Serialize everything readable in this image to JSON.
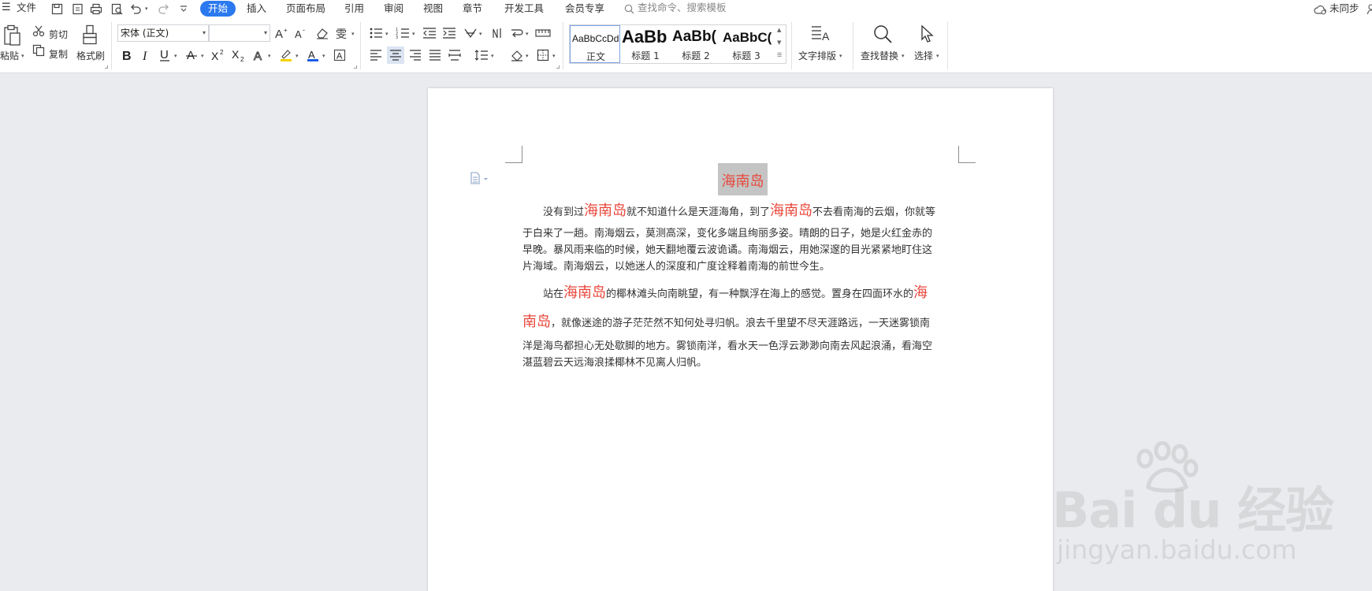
{
  "menubar": {
    "file_label": "文件",
    "tabs": [
      "开始",
      "插入",
      "页面布局",
      "引用",
      "审阅",
      "视图",
      "章节",
      "开发工具",
      "会员专享"
    ],
    "search_placeholder": "查找命令、搜索模板",
    "sync_label": "未同步"
  },
  "ribbon": {
    "clipboard": {
      "paste": "粘贴",
      "cut": "剪切",
      "copy": "复制",
      "format_painter": "格式刷"
    },
    "font": {
      "name": "宋体 (正文)",
      "size": ""
    },
    "styles": [
      {
        "sample": "AaBbCcDd",
        "name": "正文"
      },
      {
        "sample": "AaBb",
        "name": "标题 1"
      },
      {
        "sample": "AaBb(",
        "name": "标题 2"
      },
      {
        "sample": "AaBbC(",
        "name": "标题 3"
      }
    ],
    "text_layout": "文字排版",
    "find_replace": "查找替换",
    "select": "选择"
  },
  "document": {
    "title": "海南岛",
    "p1": {
      "l1_a": "没有到过",
      "l1_b": "海南岛",
      "l1_c": "就不知道什么是天涯海角，到了",
      "l1_d": "海南岛",
      "l1_e": "不去看南海的云烟，你就等",
      "l2": "于白来了一趟。南海烟云，莫测高深，变化多端且绚丽多姿。晴朗的日子，她是火红金赤的",
      "l3": "早晚。暴风雨来临的时候，她天翻地覆云波诡谲。南海烟云，用她深邃的目光紧紧地盯住这",
      "l4": "片海域。南海烟云，以她迷人的深度和广度诠释着南海的前世今生。"
    },
    "p2": {
      "l1_a": "站在",
      "l1_b": "海南岛",
      "l1_c": "的椰林滩头向南眺望，有一种飘浮在海上的感觉。置身在四面环水的",
      "l1_d": "海",
      "l2_a": "南岛",
      "l2_b": "，就像迷途的游子茫茫然不知何处寻归帆。浪去千里望不尽天涯路远，一天迷雾锁南",
      "l3": "洋是海鸟都担心无处歇脚的地方。雾锁南洋，看水天一色浮云渺渺向南去风起浪涌，看海空",
      "l4": "湛蓝碧云天远海浪揉椰林不见离人归帆。"
    }
  },
  "watermark": {
    "brand": "Bai du 经验",
    "site": "jingyan.baidu.com"
  },
  "colors": {
    "accent": "#2b79ee",
    "heading_red": "#e8463a",
    "selection_gray": "#c4c4c4"
  }
}
